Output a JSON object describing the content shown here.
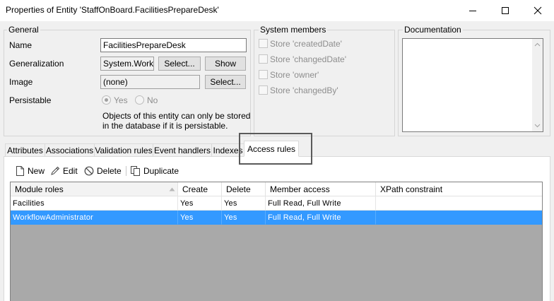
{
  "window": {
    "title": "Properties of Entity 'StaffOnBoard.FacilitiesPrepareDesk'",
    "controls": [
      "minimize-icon",
      "maximize-icon",
      "close-icon"
    ]
  },
  "general": {
    "title": "General",
    "name_label": "Name",
    "name_value": "FacilitiesPrepareDesk",
    "generalization_label": "Generalization",
    "generalization_value": "System.Workfl",
    "generalization_select": "Select...",
    "generalization_show": "Show",
    "image_label": "Image",
    "image_value": "(none)",
    "image_select": "Select...",
    "persistable_label": "Persistable",
    "persistable_yes": "Yes",
    "persistable_no": "No",
    "persistable_selected": "Yes",
    "note_line1": "Objects of this entity can only be stored",
    "note_line2": "in the database if it is persistable."
  },
  "system_members": {
    "title": "System members",
    "items": [
      "Store 'createdDate'",
      "Store 'changedDate'",
      "Store 'owner'",
      "Store 'changedBy'"
    ]
  },
  "documentation": {
    "title": "Documentation",
    "value": ""
  },
  "tabs": {
    "items": [
      "Attributes",
      "Associations",
      "Validation rules",
      "Event handlers",
      "Indexes",
      "Access rules"
    ],
    "active": "Access rules"
  },
  "toolbar": {
    "new_label": "New",
    "edit_label": "Edit",
    "delete_label": "Delete",
    "duplicate_label": "Duplicate"
  },
  "grid": {
    "columns": [
      "Module roles",
      "Create",
      "Delete",
      "Member access",
      "XPath constraint"
    ],
    "sort_column": "Module roles",
    "rows": [
      [
        "Facilities",
        "Yes",
        "Yes",
        "Full Read, Full Write",
        ""
      ],
      [
        "WorkflowAdministrator",
        "Yes",
        "Yes",
        "Full Read, Full Write",
        ""
      ]
    ],
    "selected_row": 1
  },
  "colors": {
    "selection": "#3399ff",
    "empty_grid_area": "#a9a9a9",
    "highlight_box": "#5a5a5a"
  }
}
